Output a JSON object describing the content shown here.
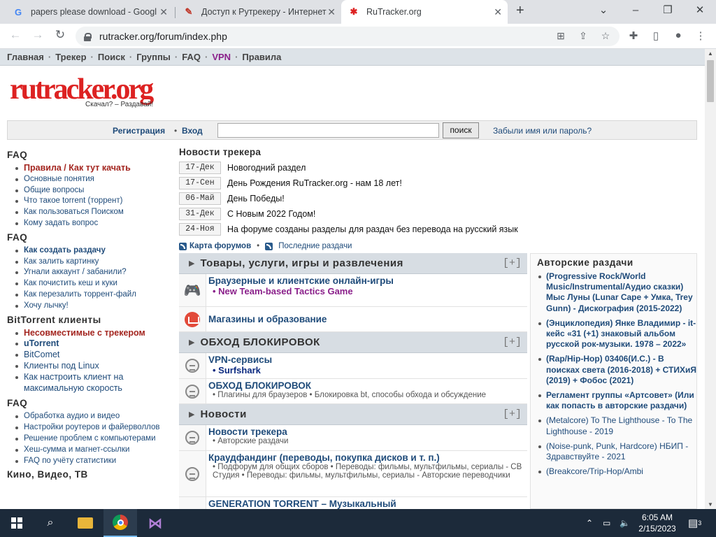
{
  "browser": {
    "tabs": [
      {
        "title": "papers please download - Googl",
        "icon": "google-icon"
      },
      {
        "title": "Доступ к Рутрекеру - Интернет",
        "icon": "rutracker-tab-icon"
      },
      {
        "title": "RuTracker.org",
        "icon": "rutracker-star-icon"
      }
    ],
    "url": "rutracker.org/forum/index.php"
  },
  "topnav": {
    "items": [
      "Главная",
      "Трекер",
      "Поиск",
      "Группы",
      "FAQ",
      "VPN",
      "Правила"
    ]
  },
  "logo": {
    "text": "rutracker.org",
    "slogan": "Скачал? – Раздавай!"
  },
  "login": {
    "register": "Регистрация",
    "enter": "Вход",
    "search_button": "поиск",
    "forgot": "Забыли имя или пароль?"
  },
  "left": {
    "sections": [
      {
        "title": "FAQ",
        "items": [
          "Правила / Как тут качать",
          "Основные понятия",
          "Общие вопросы",
          "Что такое torrent (торрент)",
          "Как пользоваться Поиском",
          "Кому задать вопрос"
        ]
      },
      {
        "title": "FAQ",
        "items": [
          "Как создать раздачу",
          "Как залить картинку",
          "Угнали аккаунт / забанили?",
          "Как почистить кеш и куки",
          "Как перезалить торрент-файл",
          "Хочу лычку!"
        ]
      },
      {
        "title": "BitTorrent клиенты",
        "items": [
          "Несовместимые с трекером",
          "uTorrent",
          "BitComet",
          "Клиенты под Linux",
          "Как настроить клиент на максимальную скорость"
        ]
      },
      {
        "title": "FAQ",
        "items": [
          "Обработка аудио и видео",
          "Настройки роутеров и файерволлов",
          "Решение проблем с компьютерами",
          "Хеш-сумма и магнет-ссылки",
          "FAQ по учёту статистики"
        ]
      },
      {
        "title": "Кино, Видео, ТВ",
        "items": []
      }
    ]
  },
  "news": {
    "title": "Новости трекера",
    "items": [
      {
        "date": "17-Дек",
        "text": "Новогодний раздел"
      },
      {
        "date": "17-Сен",
        "text": "День Рождения RuTracker.org - нам 18 лет!"
      },
      {
        "date": "06-Май",
        "text": "День Победы!"
      },
      {
        "date": "31-Дек",
        "text": "С Новым 2022 Годом!"
      },
      {
        "date": "24-Ноя",
        "text": "На форуме созданы разделы для раздач без перевода на русский язык"
      }
    ],
    "rss_map": "Карта форумов",
    "rss_latest": "Последние раздачи"
  },
  "forum": {
    "cat1": "Товары, услуги, игры и развлечения",
    "cat2": "ОБХОД БЛОКИРОВОК",
    "cat3": "Новости",
    "plus": "[+]",
    "f1": {
      "name": "Браузерные и клиентские онлайн-игры",
      "sub": "New Team-based Tactics Game"
    },
    "f2": {
      "name": "Магазины и образование"
    },
    "f3": {
      "name": "VPN-сервисы",
      "sub": "Surfshark"
    },
    "f4": {
      "name": "ОБХОД БЛОКИРОВОК",
      "sub": "Плагины для браузеров • Блокировка bt, способы обхода и обсуждение"
    },
    "f5": {
      "name": "Новости трекера",
      "sub": "Авторские раздачи"
    },
    "f6": {
      "name": "Краудфандинг (переводы, покупка дисков и т. п.)",
      "sub": "Подфорум для общих сборов • Переводы: фильмы, мультфильмы, сериалы - СВ Студия • Переводы: фильмы, мультфильмы, сериалы - Авторские переводчики"
    },
    "f7": {
      "name": "GENERATION TORRENT – Музыкальный"
    }
  },
  "side": {
    "title": "Авторские раздачи",
    "items": [
      {
        "text": "(Progressive Rock/World Music/Instrumental/Аудио сказки) Мыс Луны (Lunar Cape + Умка, Trey Gunn) - Дискография (2015-2022)",
        "bold": true
      },
      {
        "text": "(Энциклопедия) Янке Владимир - it-кейс «31 (+1) знаковый альбом русской рок-музыки. 1978 – 2022»",
        "bold": true
      },
      {
        "text": "(Rap/Hip-Hop) 03406(И.С.) - В поисках света (2016-2018) + СТИХиЯ (2019) + Фобос (2021)",
        "bold": true
      },
      {
        "text": "Регламент группы «Артсовет» (Или как попасть в авторские раздачи)",
        "bold": true
      },
      {
        "text": "(Metalcore) To The Lighthouse - To The Lighthouse - 2019",
        "bold": false
      },
      {
        "text": "(Noise-punk, Punk, Hardcore) НБИП - Здравствуйте - 2021",
        "bold": false
      },
      {
        "text": "(Breakcore/Trip-Hop/Ambi",
        "bold": false
      }
    ]
  },
  "taskbar": {
    "time": "6:05 AM",
    "date": "2/15/2023",
    "notif": "3"
  }
}
